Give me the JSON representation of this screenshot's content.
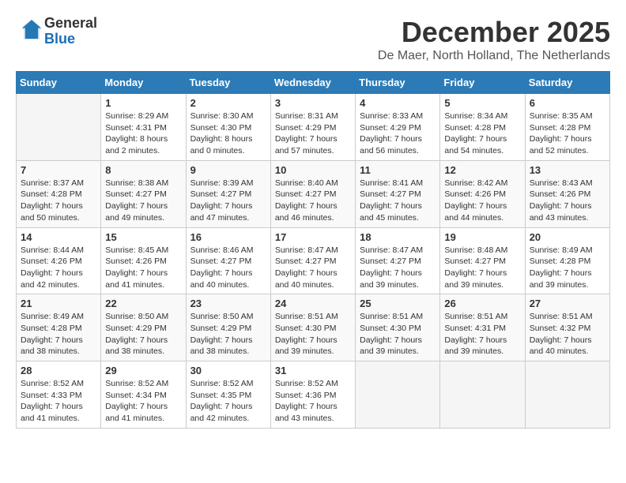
{
  "logo": {
    "general": "General",
    "blue": "Blue"
  },
  "header": {
    "month": "December 2025",
    "location": "De Maer, North Holland, The Netherlands"
  },
  "days_of_week": [
    "Sunday",
    "Monday",
    "Tuesday",
    "Wednesday",
    "Thursday",
    "Friday",
    "Saturday"
  ],
  "weeks": [
    [
      {
        "day": "",
        "sunrise": "",
        "sunset": "",
        "daylight": ""
      },
      {
        "day": "1",
        "sunrise": "Sunrise: 8:29 AM",
        "sunset": "Sunset: 4:31 PM",
        "daylight": "Daylight: 8 hours and 2 minutes."
      },
      {
        "day": "2",
        "sunrise": "Sunrise: 8:30 AM",
        "sunset": "Sunset: 4:30 PM",
        "daylight": "Daylight: 8 hours and 0 minutes."
      },
      {
        "day": "3",
        "sunrise": "Sunrise: 8:31 AM",
        "sunset": "Sunset: 4:29 PM",
        "daylight": "Daylight: 7 hours and 57 minutes."
      },
      {
        "day": "4",
        "sunrise": "Sunrise: 8:33 AM",
        "sunset": "Sunset: 4:29 PM",
        "daylight": "Daylight: 7 hours and 56 minutes."
      },
      {
        "day": "5",
        "sunrise": "Sunrise: 8:34 AM",
        "sunset": "Sunset: 4:28 PM",
        "daylight": "Daylight: 7 hours and 54 minutes."
      },
      {
        "day": "6",
        "sunrise": "Sunrise: 8:35 AM",
        "sunset": "Sunset: 4:28 PM",
        "daylight": "Daylight: 7 hours and 52 minutes."
      }
    ],
    [
      {
        "day": "7",
        "sunrise": "Sunrise: 8:37 AM",
        "sunset": "Sunset: 4:28 PM",
        "daylight": "Daylight: 7 hours and 50 minutes."
      },
      {
        "day": "8",
        "sunrise": "Sunrise: 8:38 AM",
        "sunset": "Sunset: 4:27 PM",
        "daylight": "Daylight: 7 hours and 49 minutes."
      },
      {
        "day": "9",
        "sunrise": "Sunrise: 8:39 AM",
        "sunset": "Sunset: 4:27 PM",
        "daylight": "Daylight: 7 hours and 47 minutes."
      },
      {
        "day": "10",
        "sunrise": "Sunrise: 8:40 AM",
        "sunset": "Sunset: 4:27 PM",
        "daylight": "Daylight: 7 hours and 46 minutes."
      },
      {
        "day": "11",
        "sunrise": "Sunrise: 8:41 AM",
        "sunset": "Sunset: 4:27 PM",
        "daylight": "Daylight: 7 hours and 45 minutes."
      },
      {
        "day": "12",
        "sunrise": "Sunrise: 8:42 AM",
        "sunset": "Sunset: 4:26 PM",
        "daylight": "Daylight: 7 hours and 44 minutes."
      },
      {
        "day": "13",
        "sunrise": "Sunrise: 8:43 AM",
        "sunset": "Sunset: 4:26 PM",
        "daylight": "Daylight: 7 hours and 43 minutes."
      }
    ],
    [
      {
        "day": "14",
        "sunrise": "Sunrise: 8:44 AM",
        "sunset": "Sunset: 4:26 PM",
        "daylight": "Daylight: 7 hours and 42 minutes."
      },
      {
        "day": "15",
        "sunrise": "Sunrise: 8:45 AM",
        "sunset": "Sunset: 4:26 PM",
        "daylight": "Daylight: 7 hours and 41 minutes."
      },
      {
        "day": "16",
        "sunrise": "Sunrise: 8:46 AM",
        "sunset": "Sunset: 4:27 PM",
        "daylight": "Daylight: 7 hours and 40 minutes."
      },
      {
        "day": "17",
        "sunrise": "Sunrise: 8:47 AM",
        "sunset": "Sunset: 4:27 PM",
        "daylight": "Daylight: 7 hours and 40 minutes."
      },
      {
        "day": "18",
        "sunrise": "Sunrise: 8:47 AM",
        "sunset": "Sunset: 4:27 PM",
        "daylight": "Daylight: 7 hours and 39 minutes."
      },
      {
        "day": "19",
        "sunrise": "Sunrise: 8:48 AM",
        "sunset": "Sunset: 4:27 PM",
        "daylight": "Daylight: 7 hours and 39 minutes."
      },
      {
        "day": "20",
        "sunrise": "Sunrise: 8:49 AM",
        "sunset": "Sunset: 4:28 PM",
        "daylight": "Daylight: 7 hours and 39 minutes."
      }
    ],
    [
      {
        "day": "21",
        "sunrise": "Sunrise: 8:49 AM",
        "sunset": "Sunset: 4:28 PM",
        "daylight": "Daylight: 7 hours and 38 minutes."
      },
      {
        "day": "22",
        "sunrise": "Sunrise: 8:50 AM",
        "sunset": "Sunset: 4:29 PM",
        "daylight": "Daylight: 7 hours and 38 minutes."
      },
      {
        "day": "23",
        "sunrise": "Sunrise: 8:50 AM",
        "sunset": "Sunset: 4:29 PM",
        "daylight": "Daylight: 7 hours and 38 minutes."
      },
      {
        "day": "24",
        "sunrise": "Sunrise: 8:51 AM",
        "sunset": "Sunset: 4:30 PM",
        "daylight": "Daylight: 7 hours and 39 minutes."
      },
      {
        "day": "25",
        "sunrise": "Sunrise: 8:51 AM",
        "sunset": "Sunset: 4:30 PM",
        "daylight": "Daylight: 7 hours and 39 minutes."
      },
      {
        "day": "26",
        "sunrise": "Sunrise: 8:51 AM",
        "sunset": "Sunset: 4:31 PM",
        "daylight": "Daylight: 7 hours and 39 minutes."
      },
      {
        "day": "27",
        "sunrise": "Sunrise: 8:51 AM",
        "sunset": "Sunset: 4:32 PM",
        "daylight": "Daylight: 7 hours and 40 minutes."
      }
    ],
    [
      {
        "day": "28",
        "sunrise": "Sunrise: 8:52 AM",
        "sunset": "Sunset: 4:33 PM",
        "daylight": "Daylight: 7 hours and 41 minutes."
      },
      {
        "day": "29",
        "sunrise": "Sunrise: 8:52 AM",
        "sunset": "Sunset: 4:34 PM",
        "daylight": "Daylight: 7 hours and 41 minutes."
      },
      {
        "day": "30",
        "sunrise": "Sunrise: 8:52 AM",
        "sunset": "Sunset: 4:35 PM",
        "daylight": "Daylight: 7 hours and 42 minutes."
      },
      {
        "day": "31",
        "sunrise": "Sunrise: 8:52 AM",
        "sunset": "Sunset: 4:36 PM",
        "daylight": "Daylight: 7 hours and 43 minutes."
      },
      {
        "day": "",
        "sunrise": "",
        "sunset": "",
        "daylight": ""
      },
      {
        "day": "",
        "sunrise": "",
        "sunset": "",
        "daylight": ""
      },
      {
        "day": "",
        "sunrise": "",
        "sunset": "",
        "daylight": ""
      }
    ]
  ]
}
